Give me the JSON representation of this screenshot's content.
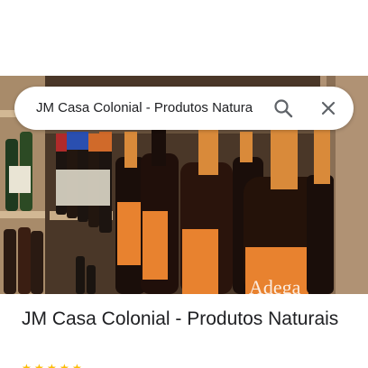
{
  "search": {
    "query": "JM Casa Colonial - Produtos Natura"
  },
  "place": {
    "title": "JM Casa Colonial - Produtos Naturais"
  },
  "photo": {
    "watermark_text": "Adega"
  },
  "rating": {
    "stars_shown": 5
  },
  "colors": {
    "text_primary": "#202124",
    "icon_gray": "#5f6368",
    "star": "#fbbc04",
    "label_orange": "#e8822f"
  }
}
